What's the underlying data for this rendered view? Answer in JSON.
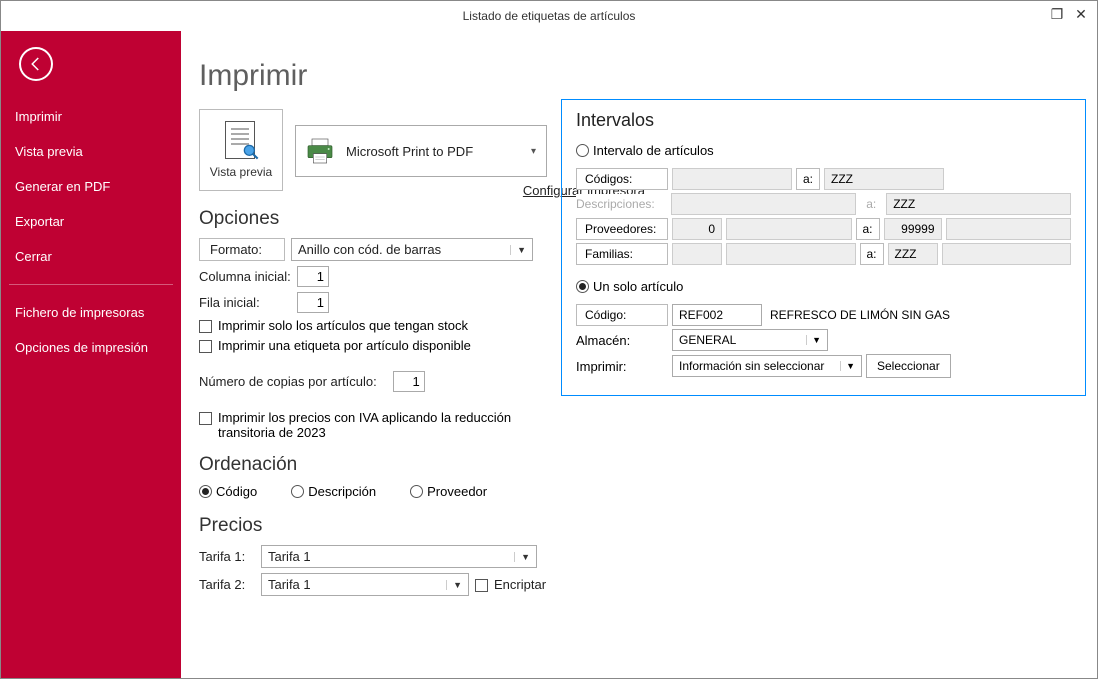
{
  "titlebar": {
    "title": "Listado de etiquetas de artículos"
  },
  "sidebar": {
    "items": [
      "Imprimir",
      "Vista previa",
      "Generar en PDF",
      "Exportar",
      "Cerrar"
    ],
    "items2": [
      "Fichero de impresoras",
      "Opciones de impresión"
    ]
  },
  "page": {
    "heading": "Imprimir"
  },
  "preview": {
    "label": "Vista previa"
  },
  "printer": {
    "name": "Microsoft Print to PDF",
    "config_link": "Configurar impresora"
  },
  "opciones": {
    "heading": "Opciones",
    "formato_label": "Formato:",
    "formato_value": "Anillo con cód. de barras",
    "col_inicial_label": "Columna inicial:",
    "col_inicial_value": "1",
    "fila_inicial_label": "Fila inicial:",
    "fila_inicial_value": "1",
    "chk_stock": "Imprimir solo los artículos que tengan stock",
    "chk_one": "Imprimir una etiqueta por artículo disponible",
    "copias_label": "Número de copias por artículo:",
    "copias_value": "1",
    "chk_iva": "Imprimir los precios con IVA aplicando la reducción transitoria de 2023"
  },
  "ordenacion": {
    "heading": "Ordenación",
    "o1": "Código",
    "o2": "Descripción",
    "o3": "Proveedor"
  },
  "precios": {
    "heading": "Precios",
    "t1_label": "Tarifa 1:",
    "t1_value": "Tarifa 1",
    "t2_label": "Tarifa 2:",
    "t2_value": "Tarifa 1",
    "encriptar": "Encriptar"
  },
  "intervalos": {
    "heading": "Intervalos",
    "r1": "Intervalo de artículos",
    "codigos_label": "Códigos:",
    "codigos_to": "ZZZ",
    "desc_label": "Descripciones:",
    "desc_to": "ZZZ",
    "prov_label": "Proveedores:",
    "prov_from": "0",
    "prov_to": "99999",
    "fam_label": "Familias:",
    "fam_to": "ZZZ",
    "a": "a:",
    "r2": "Un solo artículo",
    "codigo_label": "Código:",
    "codigo_value": "REF002",
    "codigo_desc": "REFRESCO DE LIMÓN SIN GAS",
    "almacen_label": "Almacén:",
    "almacen_value": "GENERAL",
    "imprimir_label": "Imprimir:",
    "imprimir_value": "Información sin seleccionar",
    "select_btn": "Seleccionar"
  }
}
